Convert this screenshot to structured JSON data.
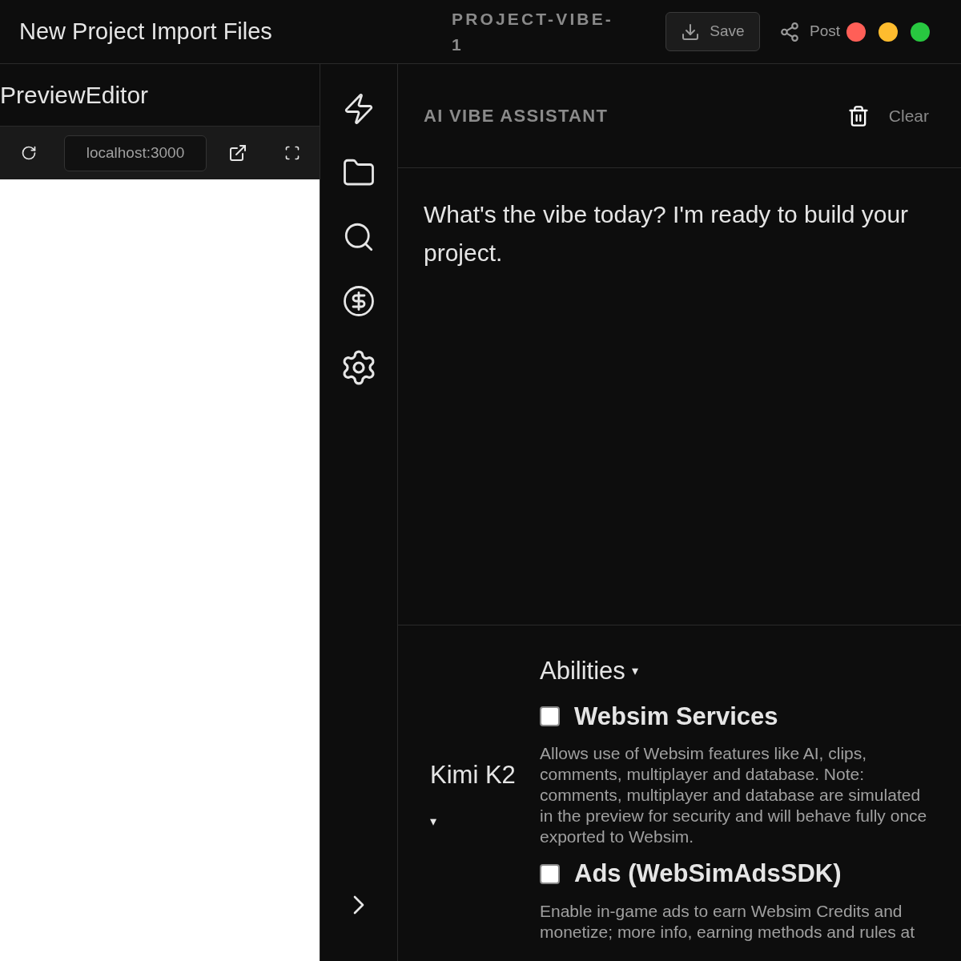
{
  "header": {
    "menu": "New Project Import Files",
    "project": "PROJECT-VIBE-1",
    "save": "Save",
    "post": "Post",
    "window_dots": [
      {
        "color": "#ff5f57"
      },
      {
        "color": "#febc2e"
      },
      {
        "color": "#28c840"
      }
    ]
  },
  "preview": {
    "title": "PreviewEditor",
    "url": "localhost:3000"
  },
  "assistant": {
    "title": "AI VIBE ASSISTANT",
    "clear": "Clear",
    "message": "What's the vibe today? I'm ready to build your project.",
    "model": {
      "name": "Kimi K2",
      "caret": "▾"
    },
    "abilities": {
      "title": "Abilities",
      "caret": "▾",
      "items": [
        {
          "label": "Websim Services",
          "checked": false,
          "description": "Allows use of Websim features like AI, clips, comments, multiplayer and database. Note: comments, multiplayer and database are simulated in the preview for security and will behave fully once exported to Websim."
        },
        {
          "label": "Ads (WebSimAdsSDK)",
          "checked": false,
          "description": "Enable in-game ads to earn Websim Credits and monetize; more info, earning methods and rules at"
        }
      ]
    }
  }
}
